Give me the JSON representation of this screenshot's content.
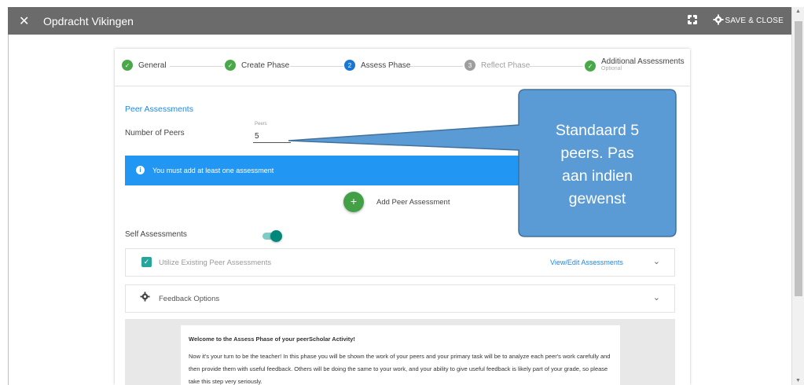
{
  "topbar": {
    "close_icon": "close-icon",
    "title": "Opdracht Vikingen",
    "fullscreen_icon": "fullscreen-icon",
    "settings_icon": "gear-icon",
    "save_label": "SAVE & CLOSE"
  },
  "stepper": {
    "steps": [
      {
        "label": "General",
        "status": "done",
        "sub": ""
      },
      {
        "label": "Create Phase",
        "status": "done",
        "sub": ""
      },
      {
        "label": "Assess Phase",
        "status": "active",
        "number": "2",
        "sub": ""
      },
      {
        "label": "Reflect Phase",
        "status": "pending",
        "number": "3",
        "sub": ""
      },
      {
        "label": "Additional Assessments",
        "status": "done",
        "sub": "Optional"
      }
    ]
  },
  "peer": {
    "title": "Peer Assessments",
    "number_label": "Number of Peers",
    "field_label": "Peers",
    "field_value": "5"
  },
  "alert": {
    "icon": "info-icon",
    "text": "You must add at least one assessment"
  },
  "add": {
    "icon": "+",
    "label": "Add Peer Assessment"
  },
  "self": {
    "label": "Self Assessments",
    "toggle_on": true
  },
  "panels": {
    "utilize_label": "Utilize Existing Peer Assessments",
    "view_edit": "View/Edit Assessments",
    "feedback_label": "Feedback Options"
  },
  "welcome": {
    "title": "Welcome to the Assess Phase of your peerScholar Activity!",
    "body": "Now it's your turn to be the teacher! In this phase you will be shown the work of your peers and your primary task will be to analyze each peer's work carefully and then provide them with useful feedback. Others will be doing the same to your work, and your ability to give useful feedback is likely part of your grade, so please take this step very seriously."
  },
  "callout": {
    "lines": [
      "Standaard 5",
      "peers. Pas",
      "aan indien",
      "gewenst"
    ]
  },
  "colors": {
    "topbar": "#6b6b6b",
    "accent_blue": "#2196f3",
    "step_done": "#4aa84a",
    "step_active": "#1976d2",
    "callout_fill": "#5b9bd5",
    "callout_stroke": "#41719c"
  }
}
